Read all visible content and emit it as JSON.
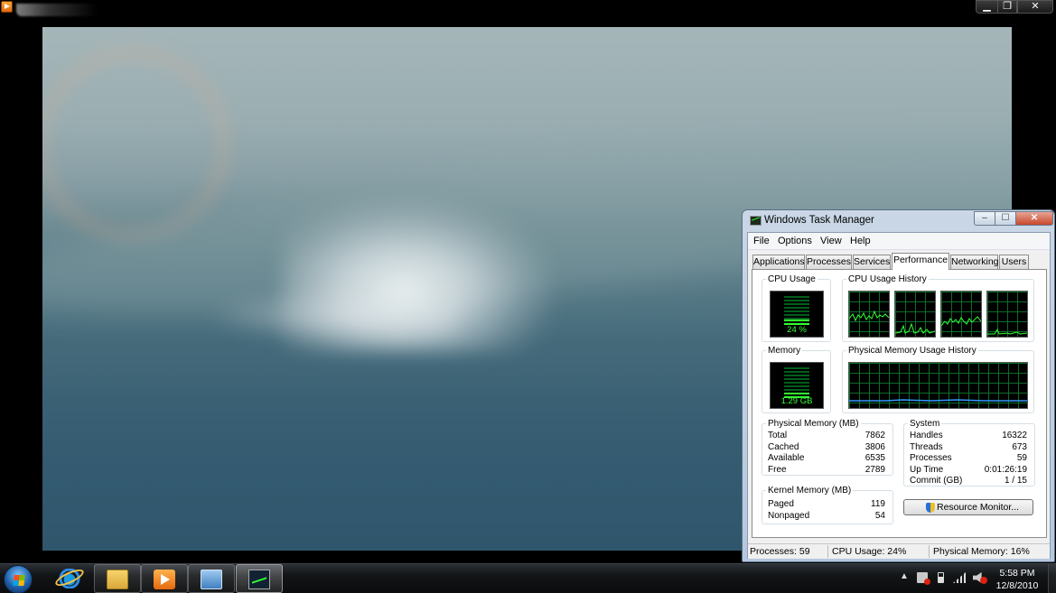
{
  "player": {
    "icon": "media-player-icon",
    "controls": {
      "minimize": "▁",
      "maximize": "❐",
      "close": "✕"
    }
  },
  "taskmanager": {
    "title": "Windows Task Manager",
    "controls": {
      "minimize": "‒",
      "maximize": "☐",
      "close": "✕"
    },
    "menu": [
      "File",
      "Options",
      "View",
      "Help"
    ],
    "tabs": [
      "Applications",
      "Processes",
      "Services",
      "Performance",
      "Networking",
      "Users"
    ],
    "active_tab": "Performance",
    "performance": {
      "cpu_usage": {
        "label": "CPU Usage",
        "value": "24 %",
        "level": 0.24
      },
      "cpu_history": {
        "label": "CPU Usage History",
        "cores": 4
      },
      "memory": {
        "label": "Memory",
        "value": "1.29 GB",
        "level": 0.16
      },
      "memory_history": {
        "label": "Physical Memory Usage History"
      },
      "physical_memory": {
        "label": "Physical Memory (MB)",
        "rows": [
          {
            "name": "Total",
            "value": "7862"
          },
          {
            "name": "Cached",
            "value": "3806"
          },
          {
            "name": "Available",
            "value": "6535"
          },
          {
            "name": "Free",
            "value": "2789"
          }
        ]
      },
      "system": {
        "label": "System",
        "rows": [
          {
            "name": "Handles",
            "value": "16322"
          },
          {
            "name": "Threads",
            "value": "673"
          },
          {
            "name": "Processes",
            "value": "59"
          },
          {
            "name": "Up Time",
            "value": "0:01:26:19"
          },
          {
            "name": "Commit (GB)",
            "value": "1 / 15"
          }
        ]
      },
      "kernel_memory": {
        "label": "Kernel Memory (MB)",
        "rows": [
          {
            "name": "Paged",
            "value": "119"
          },
          {
            "name": "Nonpaged",
            "value": "54"
          }
        ]
      },
      "resource_monitor_button": "Resource Monitor..."
    },
    "status_bar": {
      "processes": "Processes: 59",
      "cpu": "CPU Usage: 24%",
      "memory": "Physical Memory: 16%"
    }
  },
  "taskbar": {
    "start": "start-orb",
    "pinned": [
      "internet-explorer-icon",
      "windows-explorer-icon",
      "media-player-icon",
      "remote-desktop-icon",
      "task-manager-icon"
    ],
    "tray": {
      "time": "5:58 PM",
      "date": "12/8/2010",
      "show_hidden": "▲"
    }
  }
}
